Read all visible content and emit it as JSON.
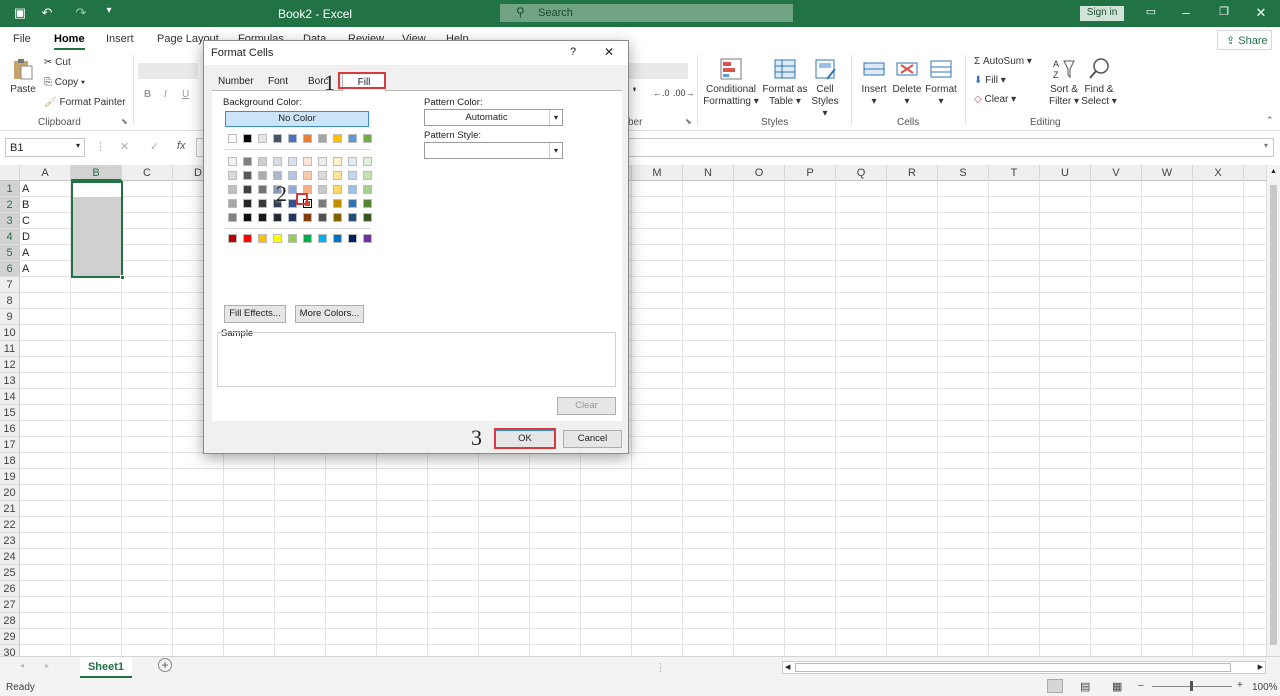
{
  "titlebar": {
    "title": "Book2  -  Excel",
    "search_placeholder": "Search",
    "signin": "Sign in"
  },
  "ribbon_tabs": [
    "File",
    "Home",
    "Insert",
    "Page Layout",
    "Formulas",
    "Data",
    "Review",
    "View",
    "Help"
  ],
  "share": "Share",
  "clipboard": {
    "paste": "Paste",
    "cut": "Cut",
    "copy": "Copy",
    "format_painter": "Format Painter",
    "group": "Clipboard"
  },
  "font_buttons": {
    "bold": "B",
    "italic": "I",
    "underline": "U"
  },
  "number_group": "ber",
  "styles": {
    "conditional": [
      "Conditional",
      "Formatting"
    ],
    "table": [
      "Format as",
      "Table"
    ],
    "cell": [
      "Cell",
      "Styles"
    ],
    "group": "Styles"
  },
  "cells": {
    "insert": "Insert",
    "delete": "Delete",
    "format": "Format",
    "group": "Cells"
  },
  "editing": {
    "autosum": "AutoSum",
    "fill": "Fill",
    "clear": "Clear",
    "sort": [
      "Sort &",
      "Filter"
    ],
    "find": [
      "Find &",
      "Select"
    ],
    "group": "Editing"
  },
  "formula_bar": {
    "name_box": "B1",
    "fx": "fx"
  },
  "columns": [
    "A",
    "B",
    "C",
    "D",
    "E",
    "F",
    "G",
    "H",
    "I",
    "J",
    "K",
    "L",
    "M",
    "N",
    "O",
    "P",
    "Q",
    "R",
    "S",
    "T",
    "U",
    "V",
    "W",
    "X"
  ],
  "column_a_values": [
    "A",
    "B",
    "C",
    "D",
    "A",
    "A"
  ],
  "rows": [
    "1",
    "2",
    "3",
    "4",
    "5",
    "6",
    "7",
    "8",
    "9",
    "10",
    "11",
    "12",
    "13",
    "14",
    "15",
    "16",
    "17",
    "18",
    "19",
    "20",
    "21",
    "22",
    "23",
    "24",
    "25",
    "26",
    "27",
    "28",
    "29",
    "30"
  ],
  "sheet_tab": "Sheet1",
  "status": {
    "ready": "Ready",
    "zoom": "100%"
  },
  "dialog": {
    "title": "Format Cells",
    "help": "?",
    "close": "✕",
    "tabs": [
      "Number",
      "Font",
      "Borc",
      "Fill"
    ],
    "background_color_label": "Background Color:",
    "no_color": "No Color",
    "fill_effects": "Fill Effects...",
    "more_colors": "More Colors...",
    "pattern_color_label": "Pattern Color:",
    "pattern_color_value": "Automatic",
    "pattern_style_label": "Pattern Style:",
    "sample_label": "Sample",
    "clear": "Clear",
    "ok": "OK",
    "cancel": "Cancel"
  },
  "palette": {
    "theme_row": [
      "#ffffff",
      "#000000",
      "#e7e6e6",
      "#44546a",
      "#4472c4",
      "#ed7d31",
      "#a5a5a5",
      "#ffc000",
      "#5b9bd5",
      "#70ad47"
    ],
    "tints": [
      [
        "#f2f2f2",
        "#7f7f7f",
        "#d0cece",
        "#d6dce4",
        "#d9e1f2",
        "#fce4d6",
        "#ededed",
        "#fff2cc",
        "#ddebf7",
        "#e2efda"
      ],
      [
        "#d9d9d9",
        "#595959",
        "#aeaaaa",
        "#acb9ca",
        "#b4c6e7",
        "#f8cbad",
        "#dbdbdb",
        "#ffe699",
        "#bdd7ee",
        "#c6e0b4"
      ],
      [
        "#bfbfbf",
        "#404040",
        "#757171",
        "#8497b0",
        "#8ea9db",
        "#f4b084",
        "#c9c9c9",
        "#ffd966",
        "#9bc2e6",
        "#a9d08e"
      ],
      [
        "#a6a6a6",
        "#262626",
        "#3a3838",
        "#333f4f",
        "#2f5496",
        "#c65911",
        "#7b7b7b",
        "#bf8f00",
        "#2f75b5",
        "#548235"
      ],
      [
        "#808080",
        "#0d0d0d",
        "#161616",
        "#222b35",
        "#203764",
        "#833c0c",
        "#525252",
        "#806000",
        "#1f4e78",
        "#375623"
      ]
    ],
    "standard": [
      "#c00000",
      "#ff0000",
      "#ffc000",
      "#ffff00",
      "#92d050",
      "#00b050",
      "#00b0f0",
      "#0070c0",
      "#002060",
      "#7030a0"
    ],
    "selected": "#c65911"
  },
  "callouts": [
    "1",
    "2",
    "3"
  ],
  "colors": {
    "excel_green": "#217346",
    "selection": "#d0d0d0",
    "callout_red": "#d83b3b"
  }
}
